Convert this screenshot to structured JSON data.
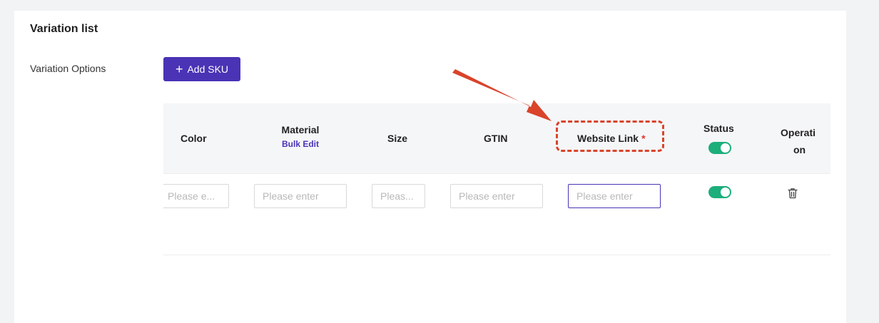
{
  "section": {
    "title": "Variation list"
  },
  "variation_options": {
    "label": "Variation Options",
    "add_button": "Add SKU"
  },
  "table": {
    "headers": {
      "color": "Color",
      "material": "Material",
      "material_action": "Bulk Edit",
      "size": "Size",
      "gtin": "GTIN",
      "website_link": "Website Link",
      "required_mark": "*",
      "status": "Status",
      "operation_line1": "Operati",
      "operation_line2": "on"
    },
    "row": {
      "color_placeholder": "Please e...",
      "material_placeholder": "Please enter",
      "size_placeholder": "Pleas...",
      "gtin_placeholder": "Please enter",
      "website_link_placeholder": "Please enter",
      "status_enabled": true
    },
    "header_status_enabled": true
  },
  "colors": {
    "accent": "#4a33b5",
    "toggle_on": "#1cae7b",
    "annotation": "#d9442b"
  },
  "icons": [
    "plus-icon",
    "trash-icon",
    "annotation-arrow"
  ]
}
